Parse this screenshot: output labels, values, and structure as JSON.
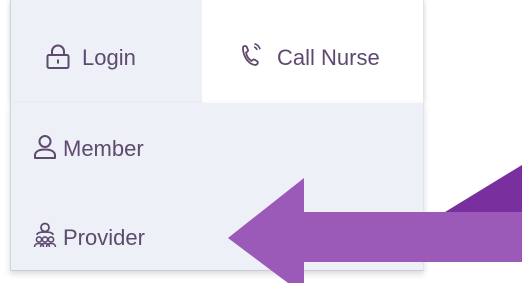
{
  "nav": {
    "login_label": "Login",
    "login_icon": "lock-icon",
    "call_label": "Call Nurse",
    "call_icon": "phone-call-icon"
  },
  "dropdown": {
    "items": [
      {
        "label": "Member",
        "icon": "person-icon"
      },
      {
        "label": "Provider",
        "icon": "provider-group-icon"
      }
    ]
  },
  "colors": {
    "text": "#5e4a6e",
    "panel_bg": "#eef0f8",
    "active_tab_bg": "#ffffff",
    "arrow_fill": "#9b59b8",
    "arrow_dark": "#7a2f9e"
  }
}
